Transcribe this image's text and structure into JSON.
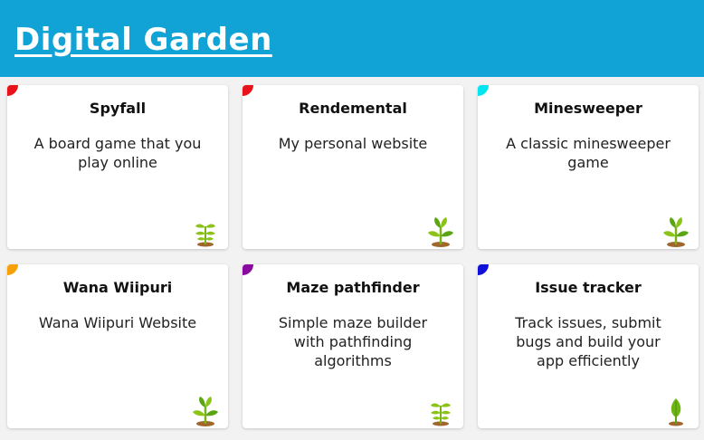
{
  "header": {
    "title": "Digital Garden",
    "background": "#11a3d6"
  },
  "cards": [
    {
      "title": "Spyfall",
      "description": "A board game that you play online",
      "accent": "#e8131a",
      "stage": "seedling-icon"
    },
    {
      "title": "Rendemental",
      "description": "My personal website",
      "accent": "#e8131a",
      "stage": "sprout-icon"
    },
    {
      "title": "Minesweeper",
      "description": "A classic minesweeper game",
      "accent": "#00e5ef",
      "stage": "sprout-icon"
    },
    {
      "title": "Wana Wiipuri",
      "description": "Wana Wiipuri Website",
      "accent": "#f5a20a",
      "stage": "sprout-icon"
    },
    {
      "title": "Maze pathfinder",
      "description": "Simple maze builder with pathfinding algorithms",
      "accent": "#8a0aa0",
      "stage": "seedling-icon"
    },
    {
      "title": "Issue tracker",
      "description": "Track issues, submit bugs and build your app efficiently",
      "accent": "#1010d8",
      "stage": "leaf-icon"
    }
  ]
}
